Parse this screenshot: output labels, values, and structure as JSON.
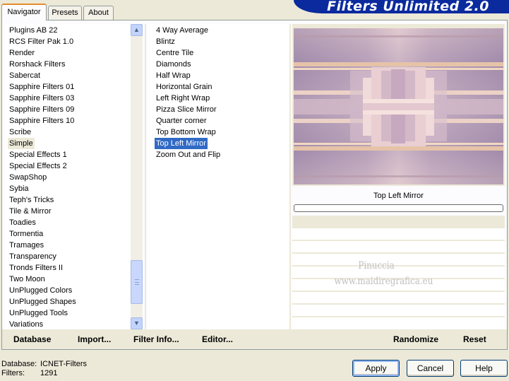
{
  "tabs": [
    {
      "label": "Navigator",
      "active": true
    },
    {
      "label": "Presets",
      "active": false
    },
    {
      "label": "About",
      "active": false
    }
  ],
  "banner": {
    "title": "Filters Unlimited 2.0"
  },
  "categories": [
    "Plugins AB 22",
    "RCS Filter Pak 1.0",
    "Render",
    "Rorshack Filters",
    "Sabercat",
    "Sapphire Filters 01",
    "Sapphire Filters 03",
    "Sapphire Filters 09",
    "Sapphire Filters 10",
    "Scribe",
    "Simple",
    "Special Effects 1",
    "Special Effects 2",
    "SwapShop",
    "Sybia",
    "Teph's Tricks",
    "Tile & Mirror",
    "Toadies",
    "Tormentia",
    "Tramages",
    "Transparency",
    "Tronds Filters II",
    "Two Moon",
    "UnPlugged Colors",
    "UnPlugged Shapes",
    "UnPlugged Tools",
    "Variations"
  ],
  "selected_category": "Simple",
  "filters": [
    "4 Way Average",
    "Blintz",
    "Centre Tile",
    "Diamonds",
    "Half Wrap",
    "Horizontal Grain",
    "Left Right Wrap",
    "Pizza Slice Mirror",
    "Quarter corner",
    "Top Bottom Wrap",
    "Top Left Mirror",
    "Zoom Out and Flip"
  ],
  "selected_filter": "Top Left Mirror",
  "preview": {
    "label": "Top Left Mirror",
    "progress": 0
  },
  "watermark": {
    "line1": "Pinuccia",
    "line2": "www.maidiregrafica.eu"
  },
  "links": {
    "database": "Database",
    "import": "Import...",
    "filter_info": "Filter Info...",
    "editor": "Editor...",
    "randomize": "Randomize",
    "reset": "Reset"
  },
  "status": {
    "database_label": "Database:",
    "database_value": "ICNET-Filters",
    "filters_label": "Filters:",
    "filters_value": "1291"
  },
  "buttons": {
    "apply": "Apply",
    "cancel": "Cancel",
    "help": "Help"
  },
  "colors": {
    "banner": "#0a2a9e",
    "selection": "#316ac5",
    "panel": "#ece9d8"
  }
}
